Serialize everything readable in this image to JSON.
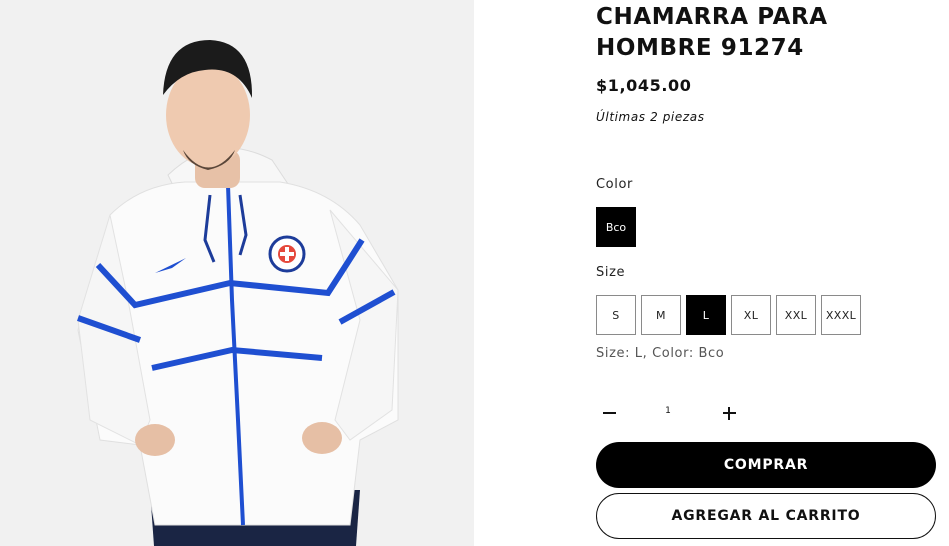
{
  "product": {
    "title": "CHAMARRA PARA HOMBRE 91274",
    "price": "$1,045.00",
    "stock_note": "Últimas 2 piezas",
    "image_alt": "white-jacket-with-blue-stripes-product-photo"
  },
  "options": {
    "color_label": "Color",
    "colors": [
      {
        "label": "Bco",
        "selected": true
      }
    ],
    "size_label": "Size",
    "sizes": [
      {
        "label": "S",
        "selected": false
      },
      {
        "label": "M",
        "selected": false
      },
      {
        "label": "L",
        "selected": true
      },
      {
        "label": "XL",
        "selected": false
      },
      {
        "label": "XXL",
        "selected": false
      },
      {
        "label": "XXXL",
        "selected": false
      }
    ],
    "variant_summary": "Size: L, Color: Bco"
  },
  "quantity": {
    "value": "1",
    "minus_icon": "minus-icon",
    "plus_icon": "plus-icon"
  },
  "actions": {
    "buy_label": "COMPRAR",
    "add_to_cart_label": "AGREGAR AL CARRITO"
  },
  "colors": {
    "primary": "#000000",
    "background": "#ffffff",
    "image_bg": "#f1f1f1",
    "jacket_stripe": "#1f4fd1"
  }
}
